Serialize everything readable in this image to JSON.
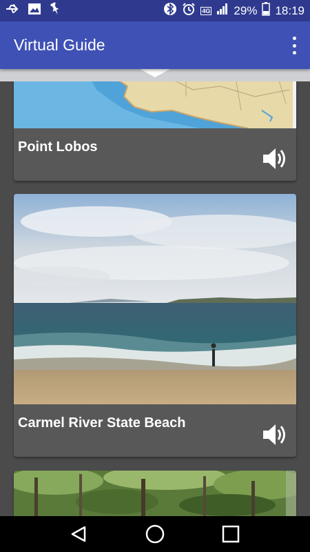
{
  "status_bar": {
    "battery": "29%",
    "time": "18:19",
    "network": "4G",
    "left_icons": [
      "usb-icon",
      "image-icon",
      "pin-icon"
    ],
    "right_icons": [
      "bluetooth-icon",
      "alarm-icon",
      "signal-icon",
      "battery-icon"
    ]
  },
  "app_bar": {
    "title": "Virtual Guide",
    "menu_icon": "overflow-menu-icon",
    "color": "#3f51b5"
  },
  "cards": [
    {
      "title": "Point Lobos",
      "image": "map-image",
      "audio_icon": "speaker-icon"
    },
    {
      "title": "Carmel River State Beach",
      "image": "beach-photo",
      "audio_icon": "speaker-icon"
    },
    {
      "title": "",
      "image": "forest-photo"
    }
  ],
  "nav_bar": {
    "buttons": [
      "back-icon",
      "home-icon",
      "recents-icon"
    ]
  }
}
